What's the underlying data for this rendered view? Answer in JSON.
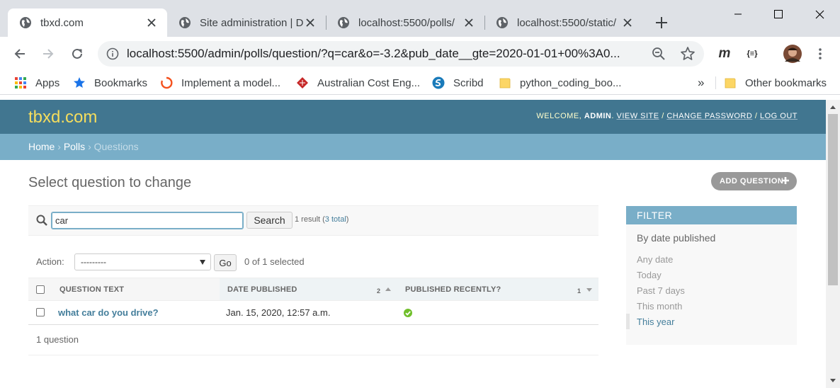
{
  "browser": {
    "tabs": [
      {
        "title": "tbxd.com",
        "active": true
      },
      {
        "title": "Site administration | D",
        "active": false
      },
      {
        "title": "localhost:5500/polls/",
        "active": false
      },
      {
        "title": "localhost:5500/static/",
        "active": false
      }
    ],
    "address": "localhost:5500/admin/polls/question/?q=car&o=-3.2&pub_date__gte=2020-01-01+00%3A0...",
    "bookmarks": [
      {
        "label": "Apps",
        "icon": "apps-grid-icon"
      },
      {
        "label": "Bookmarks",
        "icon": "star-icon"
      },
      {
        "label": "Implement a model...",
        "icon": "spinner-icon"
      },
      {
        "label": "Australian Cost Eng...",
        "icon": "cube-icon"
      },
      {
        "label": "Scribd",
        "icon": "scribd-icon"
      },
      {
        "label": "python_coding_boo...",
        "icon": "folder-icon"
      }
    ],
    "bookmarks_overflow": "»",
    "other_bookmarks": "Other bookmarks",
    "extensions": {
      "m_label": "m",
      "json_label": "{≡}"
    }
  },
  "site": {
    "brand": "tbxd.com",
    "user_tools": {
      "welcome": "WELCOME,",
      "user": "ADMIN",
      "view_site": "VIEW SITE",
      "change_password": "CHANGE PASSWORD",
      "log_out": "LOG OUT"
    },
    "breadcrumbs": {
      "home": "Home",
      "polls": "Polls",
      "current": "Questions",
      "sep": "›"
    },
    "title": "Select question to change",
    "add_button": "ADD QUESTION"
  },
  "search": {
    "value": "car",
    "button": "Search",
    "result_prefix": "1 result (",
    "total_link": "3 total",
    "result_suffix": ")"
  },
  "actions": {
    "label": "Action:",
    "selected_option": "---------",
    "go": "Go",
    "count": "0 of 1 selected"
  },
  "table": {
    "headers": {
      "question_text": "QUESTION TEXT",
      "date_published": "DATE PUBLISHED",
      "published_recently": "PUBLISHED RECENTLY?"
    },
    "sort": {
      "date_published_priority": "2",
      "published_recently_priority": "1"
    },
    "rows": [
      {
        "question_text": "what car do you drive?",
        "date_published": "Jan. 15, 2020, 12:57 a.m.",
        "published_recently": true
      }
    ],
    "footer": "1 question"
  },
  "filter": {
    "heading": "FILTER",
    "section": "By date published",
    "options": [
      "Any date",
      "Today",
      "Past 7 days",
      "This month",
      "This year"
    ],
    "selected": "This year"
  },
  "colors": {
    "header_bg": "#417690",
    "brand": "#f5dd5d",
    "breadcrumbs_bg": "#79aec8",
    "link": "#447e9b",
    "success": "#70bf2b"
  }
}
